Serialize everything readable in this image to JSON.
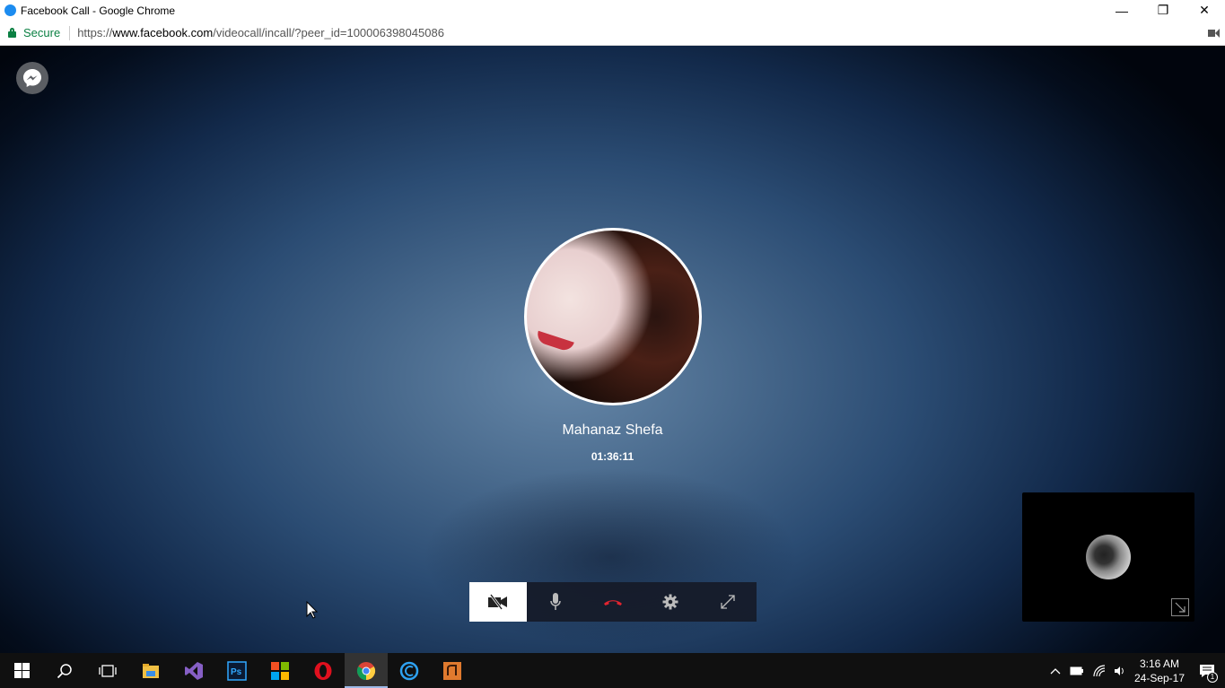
{
  "window": {
    "title": "Facebook Call - Google Chrome",
    "minimize_glyph": "—",
    "restore_glyph": "❐",
    "close_glyph": "✕"
  },
  "address_bar": {
    "secure_label": "Secure",
    "url_scheme": "https://",
    "url_host": "www.facebook.com",
    "url_path": "/videocall/incall/?peer_id=100006398045086"
  },
  "call": {
    "peer_name": "Mahanaz Shefa",
    "duration": "01:36:11",
    "controls": [
      {
        "name": "video-off",
        "active": true
      },
      {
        "name": "microphone",
        "active": false
      },
      {
        "name": "end-call",
        "active": false
      },
      {
        "name": "settings",
        "active": false
      },
      {
        "name": "fullscreen",
        "active": false
      }
    ],
    "end_call_color": "#e0242f"
  },
  "taskbar": {
    "apps": [
      "start",
      "search",
      "task-view",
      "file-explorer",
      "visual-studio",
      "photoshop",
      "windows-store",
      "opera",
      "chrome",
      "ccleaner",
      "app-orange"
    ],
    "active_app": "chrome",
    "clock_time": "3:16 AM",
    "clock_date": "24-Sep-17",
    "notification_count": "1"
  },
  "colors": {
    "secure_green": "#0b8043",
    "messenger_gray": "#5b5e63",
    "taskbar_bg": "#101010"
  }
}
